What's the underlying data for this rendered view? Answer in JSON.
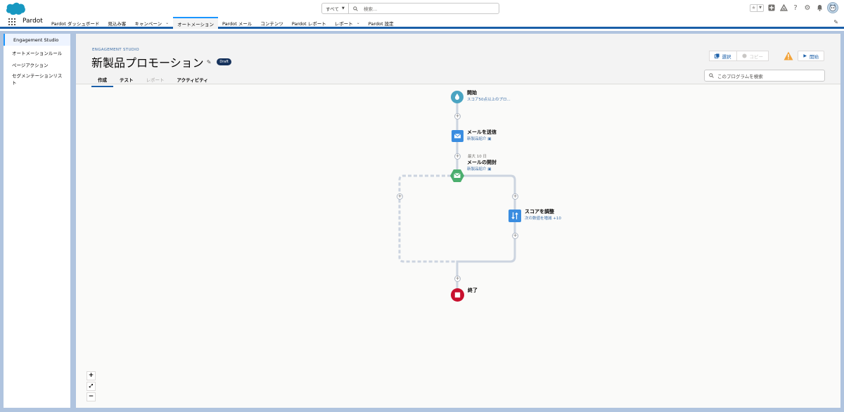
{
  "header": {
    "search_scope": "すべて",
    "search_placeholder": "検索...",
    "icons": [
      "favorites-star-icon",
      "favorites-list-icon",
      "add-icon",
      "trailhead-icon",
      "help-icon",
      "setup-gear-icon",
      "notification-bell-icon",
      "avatar"
    ]
  },
  "nav": {
    "app_name": "Pardot",
    "items": [
      {
        "label": "Pardot ダッシュボード",
        "dropdown": false
      },
      {
        "label": "見込み客",
        "dropdown": false
      },
      {
        "label": "キャンペーン",
        "dropdown": true
      },
      {
        "label": "オートメーション",
        "dropdown": false,
        "active": true
      },
      {
        "label": "Pardot メール",
        "dropdown": false
      },
      {
        "label": "コンテンツ",
        "dropdown": false
      },
      {
        "label": "Pardot レポート",
        "dropdown": false
      },
      {
        "label": "レポート",
        "dropdown": true
      },
      {
        "label": "Pardot 設定",
        "dropdown": false
      }
    ]
  },
  "sidebar": {
    "items": [
      {
        "label": "Engagement Studio",
        "active": true
      },
      {
        "label": "オートメーションルール"
      },
      {
        "label": "ページアクション"
      },
      {
        "label": "セグメンテーションリスト"
      }
    ]
  },
  "program": {
    "eyebrow": "ENGAGEMENT STUDIO",
    "title": "新製品プロモーション",
    "status": "Draft",
    "tabs": [
      {
        "label": "作成",
        "active": true
      },
      {
        "label": "テスト"
      },
      {
        "label": "レポート",
        "disabled": true
      },
      {
        "label": "アクティビティ"
      }
    ],
    "buttons": {
      "select": "選択",
      "copy": "コピー",
      "start": "開始"
    },
    "search_placeholder": "このプログラムを検索"
  },
  "flow": {
    "start": {
      "label": "開始",
      "sub": "スコア50点以上のプロ..."
    },
    "send_email": {
      "label": "メールを送信",
      "sub": "新製品紹介"
    },
    "open_email": {
      "wait": "最大 10 日",
      "label": "メールの開封",
      "sub": "新製品紹介"
    },
    "adjust_score": {
      "label": "スコアを調整",
      "sub": "次の数値を増減 +10"
    },
    "end": {
      "label": "終了"
    }
  },
  "zoom": {
    "in": "+",
    "fit": "⤢",
    "out": "−"
  },
  "colors": {
    "brand_blue": "#1b5fa8",
    "start_teal": "#4aa4c2",
    "email_blue": "#3a8de0",
    "trigger_green": "#4bae6e",
    "end_red": "#c8102e",
    "warning": "#f2a33a"
  }
}
